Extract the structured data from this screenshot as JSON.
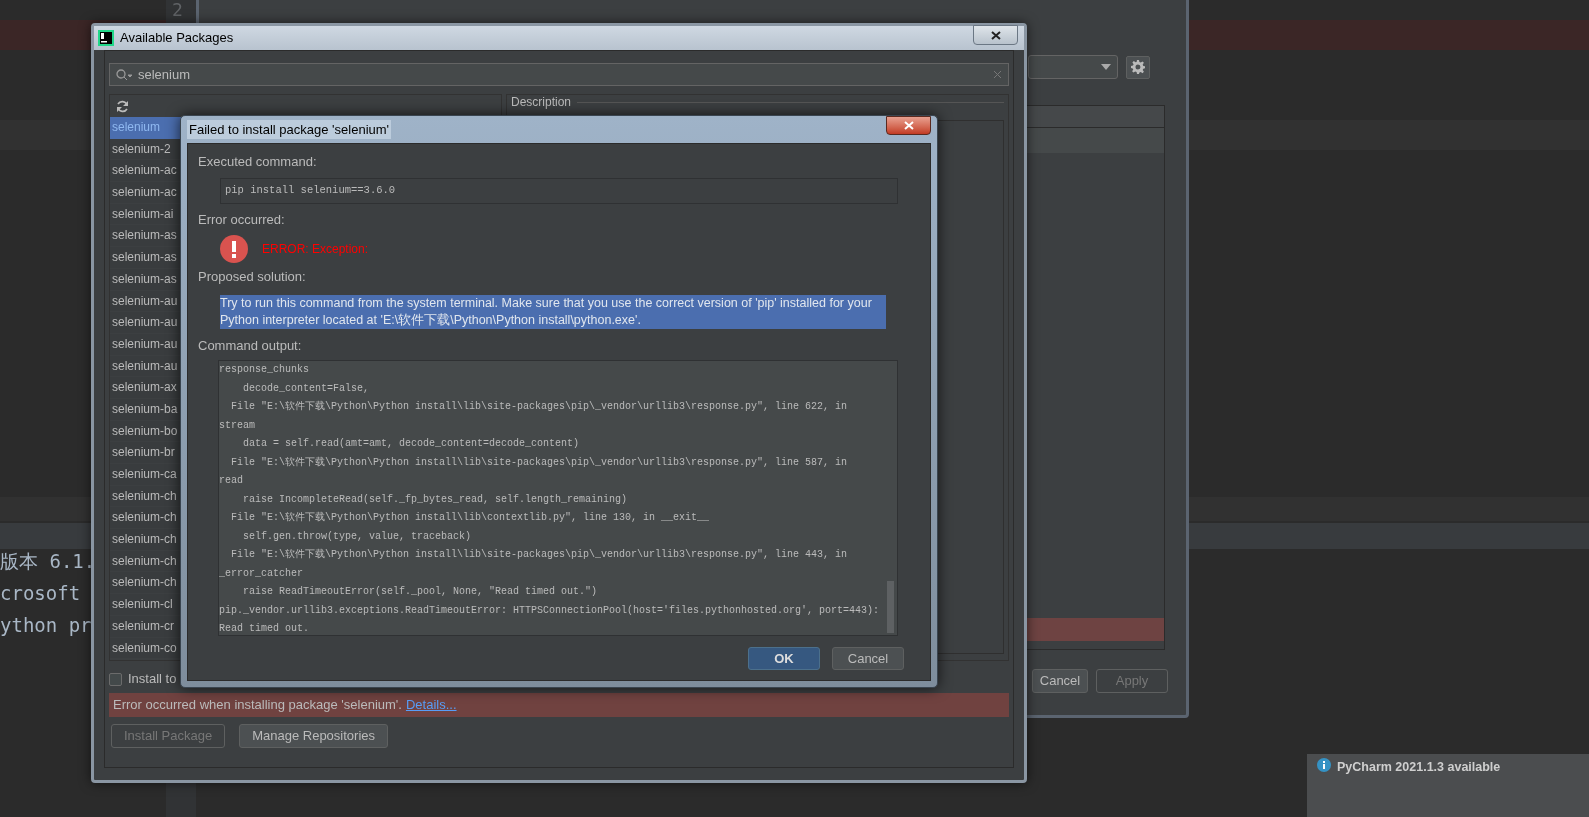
{
  "editor": {
    "line_number": "2",
    "lines": [
      "版本 6.1.",
      "crosoft ",
      "ython pr"
    ]
  },
  "settings_window": {
    "buttons": [
      {
        "label": "Cancel",
        "disabled": false
      },
      {
        "label": "Apply",
        "disabled": true
      }
    ]
  },
  "packages_window": {
    "title": "Available Packages",
    "search": {
      "value": "selenium"
    },
    "packages": [
      {
        "name": "selenium",
        "selected": true
      },
      {
        "name": "selenium-2",
        "selected": false
      },
      {
        "name": "selenium-ac",
        "selected": false
      },
      {
        "name": "selenium-ac",
        "selected": false
      },
      {
        "name": "selenium-ai",
        "selected": false
      },
      {
        "name": "selenium-as",
        "selected": false
      },
      {
        "name": "selenium-as",
        "selected": false
      },
      {
        "name": "selenium-as",
        "selected": false
      },
      {
        "name": "selenium-au",
        "selected": false
      },
      {
        "name": "selenium-au",
        "selected": false
      },
      {
        "name": "selenium-au",
        "selected": false
      },
      {
        "name": "selenium-au",
        "selected": false
      },
      {
        "name": "selenium-ax",
        "selected": false
      },
      {
        "name": "selenium-ba",
        "selected": false
      },
      {
        "name": "selenium-bo",
        "selected": false
      },
      {
        "name": "selenium-br",
        "selected": false
      },
      {
        "name": "selenium-ca",
        "selected": false
      },
      {
        "name": "selenium-ch",
        "selected": false
      },
      {
        "name": "selenium-ch",
        "selected": false
      },
      {
        "name": "selenium-ch",
        "selected": false
      },
      {
        "name": "selenium-ch",
        "selected": false
      },
      {
        "name": "selenium-ch",
        "selected": false
      },
      {
        "name": "selenium-cl",
        "selected": false
      },
      {
        "name": "selenium-cr",
        "selected": false
      },
      {
        "name": "selenium-co",
        "selected": false
      }
    ],
    "description_label": "Description",
    "install_to": {
      "label": "Install to",
      "checked": false
    },
    "error": {
      "message": "Error occurred when installing package 'selenium'.",
      "link": "Details..."
    },
    "buttons": [
      {
        "label": "Install Package",
        "disabled": true
      },
      {
        "label": "Manage Repositories",
        "disabled": false
      }
    ]
  },
  "error_dialog": {
    "title": "Failed to install package 'selenium'",
    "executed_label": "Executed command:",
    "command": "pip install selenium==3.6.0",
    "error_label": "Error occurred:",
    "error_text": "ERROR: Exception:",
    "solution_label": "Proposed solution:",
    "solution": "Try to run this command from the system terminal. Make sure that you use the correct version of 'pip' installed for your Python interpreter located at 'E:\\软件下载\\Python\\Python install\\python.exe'.",
    "output_label": "Command output:",
    "output_lines": [
      "response_chunks",
      "    decode_content=False,",
      "  File \"E:\\软件下载\\Python\\Python install\\lib\\site-packages\\pip\\_vendor\\urllib3\\response.py\", line 622, in",
      "stream",
      "    data = self.read(amt=amt, decode_content=decode_content)",
      "  File \"E:\\软件下载\\Python\\Python install\\lib\\site-packages\\pip\\_vendor\\urllib3\\response.py\", line 587, in",
      "read",
      "    raise IncompleteRead(self._fp_bytes_read, self.length_remaining)",
      "  File \"E:\\软件下载\\Python\\Python install\\lib\\contextlib.py\", line 130, in __exit__",
      "    self.gen.throw(type, value, traceback)",
      "  File \"E:\\软件下载\\Python\\Python install\\lib\\site-packages\\pip\\_vendor\\urllib3\\response.py\", line 443, in",
      "_error_catcher",
      "    raise ReadTimeoutError(self._pool, None, \"Read timed out.\")",
      "pip._vendor.urllib3.exceptions.ReadTimeoutError: HTTPSConnectionPool(host='files.pythonhosted.org', port=443):",
      "Read timed out."
    ],
    "buttons": [
      {
        "label": "OK",
        "default": true
      },
      {
        "label": "Cancel",
        "default": false
      }
    ]
  },
  "notification": {
    "title": "PyCharm 2021.1.3 available"
  }
}
